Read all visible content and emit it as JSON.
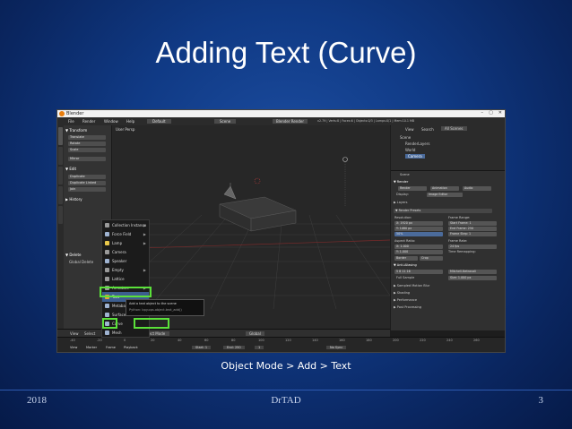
{
  "slide": {
    "title": "Adding Text (Curve)",
    "caption": "Object Mode > Add > Text",
    "footer_left": "2018",
    "footer_center": "DrTAD",
    "footer_right": "3"
  },
  "window": {
    "title": "Blender",
    "controls": [
      "–",
      "▢",
      "✕"
    ],
    "menubar": [
      "File",
      "Render",
      "Window",
      "Help",
      "Default",
      "Scene",
      "Blender Render",
      "v2.79 | Verts:8 | Faces:6 | Objects:0/3 | Lamps:0/1 | Mem:10.1 MB"
    ]
  },
  "toolshelf": {
    "transform_header": "▼ Transform",
    "transform_buttons": [
      "Translate",
      "Rotate",
      "Scale"
    ],
    "mirror": "Mirror",
    "edit_header": "▼ Edit",
    "edit_buttons": [
      "Duplicate",
      "Duplicate Linked",
      "Join"
    ],
    "history_header": "▶ History",
    "delete_header": "▼ Delete",
    "global_delete": "Global Delete",
    "tabs": [
      "Tools",
      "Create",
      "Relations",
      "Animation",
      "Physics"
    ]
  },
  "viewport": {
    "label": "User Persp",
    "header_items": [
      "View",
      "Select",
      "Add",
      "Object",
      "Object Mode",
      "Global"
    ]
  },
  "add_menu": {
    "items": [
      {
        "label": "Collection Instance",
        "color": "#9a9a9a"
      },
      {
        "label": "Force Field",
        "color": "#9fb3d1"
      },
      {
        "label": "Lamp",
        "color": "#e8c74a"
      },
      {
        "label": "Camera",
        "color": "#9a9a9a"
      },
      {
        "label": "Speaker",
        "color": "#9fb3d1"
      },
      {
        "label": "Empty",
        "color": "#9a9a9a"
      },
      {
        "label": "Lattice",
        "color": "#9a9a9a"
      },
      {
        "label": "Armature",
        "color": "#9a9a9a"
      },
      {
        "label": "Text",
        "color": "#e8a23a"
      },
      {
        "label": "Metaball",
        "color": "#9fb3d1"
      },
      {
        "label": "Surface",
        "color": "#9fb3d1"
      },
      {
        "label": "Curve",
        "color": "#9fb3d1"
      },
      {
        "label": "Mesh",
        "color": "#9fb3d1"
      }
    ],
    "tooltip_line1": "Add a text object to the scene",
    "tooltip_line2": "Python: bpy.ops.object.text_add()"
  },
  "outliner": {
    "tabs": [
      "View",
      "Search",
      "All Scenes"
    ],
    "items": [
      "Scene",
      "RenderLayers",
      "World",
      "Camera"
    ]
  },
  "properties": {
    "header": "Scene",
    "render_header": "▼ Render",
    "render_buttons": [
      "Render",
      "Animation",
      "Audio"
    ],
    "display_label": "Display:",
    "display_value": "Image Editor",
    "layer_label": "▶ Layers",
    "dimensions_header": "▼ Render Presets",
    "resolution_label": "Resolution:",
    "res_x": "X: 1920 px",
    "res_y": "Y: 1080 px",
    "res_pct": "50%",
    "frame_range_label": "Frame Range:",
    "start_frame": "Start Frame: 1",
    "end_frame": "End Frame: 250",
    "frame_step": "Frame Step: 1",
    "aspect_label": "Aspect Ratio:",
    "aspect_x": "X: 1.000",
    "aspect_y": "Y: 1.000",
    "frame_rate_label": "Frame Rate:",
    "fps": "24 fps",
    "time_remap": "Time Remapping:",
    "border": "Border",
    "crop": "Crop",
    "anti_alias": "▼ Anti-Aliasing",
    "aa_samples": "5  8  11  16",
    "mitchell": "Mitchell-Netravali",
    "full_sample": "Full Sample",
    "size_px": "Size: 1.000 px",
    "sampled_motion": "▶ Sampled Motion Blur",
    "shading": "▶ Shading",
    "performance": "▶ Performance",
    "post_processing": "▶ Post Processing"
  },
  "timeline": {
    "ticks": [
      "-40",
      "-20",
      "0",
      "20",
      "40",
      "60",
      "80",
      "100",
      "120",
      "140",
      "160",
      "180",
      "200",
      "220",
      "240",
      "260"
    ],
    "controls": [
      "View",
      "Marker",
      "Frame",
      "Playback",
      "Start: 1",
      "End: 250",
      "1",
      "No Sync"
    ]
  }
}
